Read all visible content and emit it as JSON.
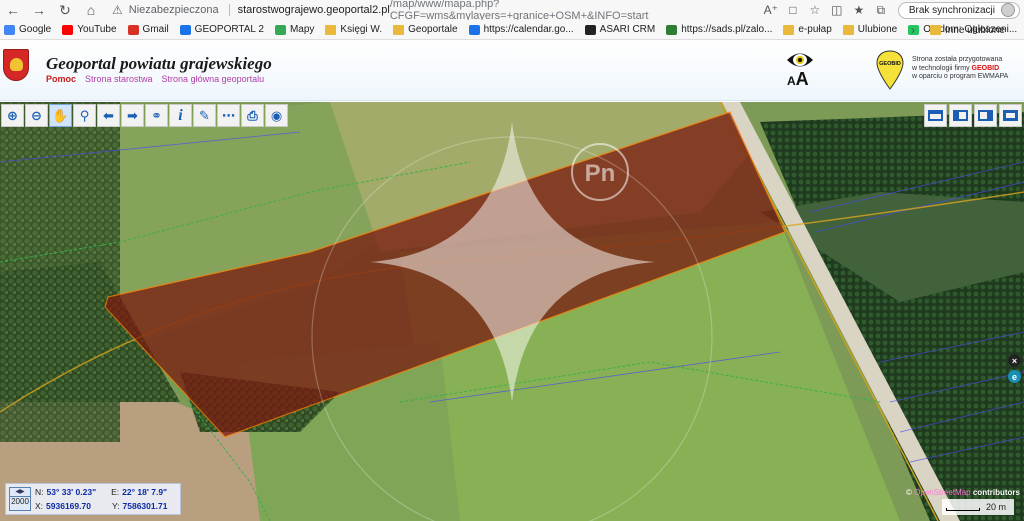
{
  "browser": {
    "security_label": "Niezabezpieczona",
    "url_host": "starostwograjewo.geoportal2.pl",
    "url_path": "/map/www/mapa.php?CFGF=wms&mylayers=+granice+OSM+&INFO=start",
    "sync_label": "Brak synchronizacji"
  },
  "bookmarks": [
    {
      "label": "Google",
      "icon": "google-icon",
      "color": "#4285f4"
    },
    {
      "label": "YouTube",
      "icon": "youtube-icon",
      "color": "#ff0000"
    },
    {
      "label": "Gmail",
      "icon": "gmail-icon",
      "color": "#d93025"
    },
    {
      "label": "GEOPORTAL 2",
      "icon": "geoportal-icon",
      "color": "#1a73e8"
    },
    {
      "label": "Mapy",
      "icon": "maps-icon",
      "color": "#34a853"
    },
    {
      "label": "Księgi W.",
      "icon": "folder-icon",
      "color": "#e8b93a"
    },
    {
      "label": "Geoportale",
      "icon": "folder-icon",
      "color": "#e8b93a"
    },
    {
      "label": "https://calendar.go...",
      "icon": "calendar-icon",
      "color": "#1a73e8"
    },
    {
      "label": "ASARI CRM",
      "icon": "asari-icon",
      "color": "#222222"
    },
    {
      "label": "https://sads.pl/zalo...",
      "icon": "sads-icon",
      "color": "#2e7d32"
    },
    {
      "label": "e-pułap",
      "icon": "folder-icon",
      "color": "#e8b93a"
    },
    {
      "label": "Ulubione",
      "icon": "folder-icon",
      "color": "#e8b93a"
    },
    {
      "label": "Otodom: Ogłoszeni...",
      "icon": "otodom-icon",
      "color": "#22c55e"
    }
  ],
  "bookmarks_other": "Inne ulubione",
  "portal": {
    "title": "Geoportal powiatu grajewskiego",
    "links": [
      "Pomoc",
      "Strona starostwa",
      "Strona główna geoportalu"
    ],
    "aa_small": "A",
    "aa_large": "A",
    "geobid_logo_text": "GEOBID",
    "geobid_line1": "Strona została przygotowana",
    "geobid_line2_pre": "w technologii firmy ",
    "geobid_line2_brand": "GEOBID",
    "geobid_line3": "w oparciu o program EWMAPA"
  },
  "map": {
    "watermark": "Pn",
    "coords": {
      "scale": "2000",
      "n_label": "N:",
      "n_value": "53° 33' 0.23\"",
      "e_label": "E:",
      "e_value": "22° 18' 7.9\"",
      "x_label": "X:",
      "x_value": "5936169.70",
      "y_label": "Y:",
      "y_value": "7586301.71"
    },
    "attribution_prefix": "©",
    "attribution_link": "OpenStreetMap",
    "attribution_suffix": "contributors",
    "scalebar_label": "20 m"
  },
  "toolbar_icons": [
    "zoom-in-icon",
    "zoom-out-icon",
    "pan-hand-icon",
    "zoom-window-icon",
    "back-arrow-icon",
    "forward-arrow-icon",
    "link-icon",
    "info-icon",
    "edit-icon",
    "measure-icon",
    "print-icon",
    "globe-icon"
  ],
  "colors": {
    "parcel": "#7a1a10",
    "link": "#b23ea7",
    "accent": "#1a5fb4"
  }
}
